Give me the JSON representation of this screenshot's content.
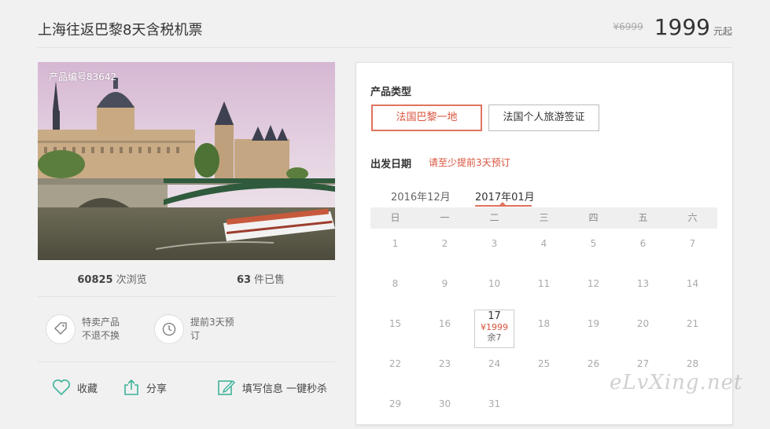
{
  "header": {
    "title": "上海往返巴黎8天含税机票",
    "old_price": "¥6999",
    "price": "1999",
    "unit": "元起"
  },
  "product": {
    "id_label": "产品编号83642",
    "views_count": "60825",
    "views_label": "次浏览",
    "sold_count": "63",
    "sold_label": "件已售"
  },
  "features": [
    {
      "icon": "tag-icon",
      "text": "特卖产品 不退不换"
    },
    {
      "icon": "clock-icon",
      "text": "提前3天预订"
    }
  ],
  "actions": {
    "favorite": "收藏",
    "share": "分享",
    "fill": "填写信息 一键秒杀"
  },
  "booking": {
    "type_label": "产品类型",
    "options": [
      "法国巴黎一地",
      "法国个人旅游签证"
    ],
    "selected_option": 0,
    "date_label": "出发日期",
    "date_note": "请至少提前3天预订",
    "months": [
      "2016年12月",
      "2017年01月"
    ],
    "active_month": 1,
    "weekdays": [
      "日",
      "一",
      "二",
      "三",
      "四",
      "五",
      "六"
    ],
    "weeks": [
      [
        "1",
        "2",
        "3",
        "4",
        "5",
        "6",
        "7"
      ],
      [
        "8",
        "9",
        "10",
        "11",
        "12",
        "13",
        "14"
      ],
      [
        "15",
        "16",
        "17",
        "18",
        "19",
        "20",
        "21"
      ],
      [
        "22",
        "23",
        "24",
        "25",
        "26",
        "27",
        "28"
      ],
      [
        "29",
        "30",
        "31",
        "",
        "",
        "",
        ""
      ]
    ],
    "selected_day": {
      "day": "17",
      "price": "¥1999",
      "remaining": "余7"
    }
  },
  "watermark": "eLvXing.net",
  "colors": {
    "accent": "#e0735e",
    "accent_text": "#d9533c",
    "icon_green": "#3fb39a"
  }
}
